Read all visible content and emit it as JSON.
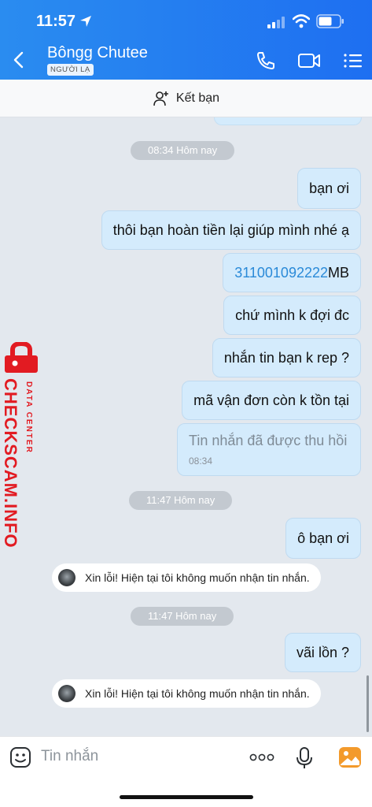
{
  "status": {
    "time": "11:57"
  },
  "header": {
    "contact_name": "Bôngg Chutee",
    "badge": "NGƯỜI LẠ"
  },
  "add_friend": {
    "label": "Kết bạn"
  },
  "messages": [
    {
      "type": "time",
      "text": "08:34 Hôm nay"
    },
    {
      "type": "sent",
      "text": "bạn ơi"
    },
    {
      "type": "sent",
      "text": "thôi bạn hoàn tiền lại giúp mình nhé ạ"
    },
    {
      "type": "sent",
      "link": "311001092222",
      "text": " MB"
    },
    {
      "type": "sent",
      "text": "chứ mình k đợi đc"
    },
    {
      "type": "sent",
      "text": "nhắn tin bạn k rep ?"
    },
    {
      "type": "sent",
      "text": "mã vận đơn còn k tồn tại"
    },
    {
      "type": "recalled",
      "text": "Tin nhắn đã được thu hồi",
      "time": "08:34"
    },
    {
      "type": "time",
      "text": "11:47 Hôm nay"
    },
    {
      "type": "sent",
      "text": "ô bạn ơi"
    },
    {
      "type": "system",
      "text": "Xin lỗi! Hiện tại tôi không muốn nhận tin nhắn."
    },
    {
      "type": "time",
      "text": "11:47 Hôm nay"
    },
    {
      "type": "sent",
      "text": "vãi lồn ?"
    },
    {
      "type": "system",
      "text": "Xin lỗi! Hiện tại tôi không muốn nhận tin nhắn."
    }
  ],
  "watermark": {
    "main": "CHECKSCAM.INFO",
    "sub": "DATA CENTER"
  },
  "input": {
    "placeholder": "Tin nhắn"
  },
  "colors": {
    "header": "#1e6ff1",
    "bubble": "#d4ebfc",
    "link": "#2a8ad8",
    "watermark": "#e21b22"
  }
}
